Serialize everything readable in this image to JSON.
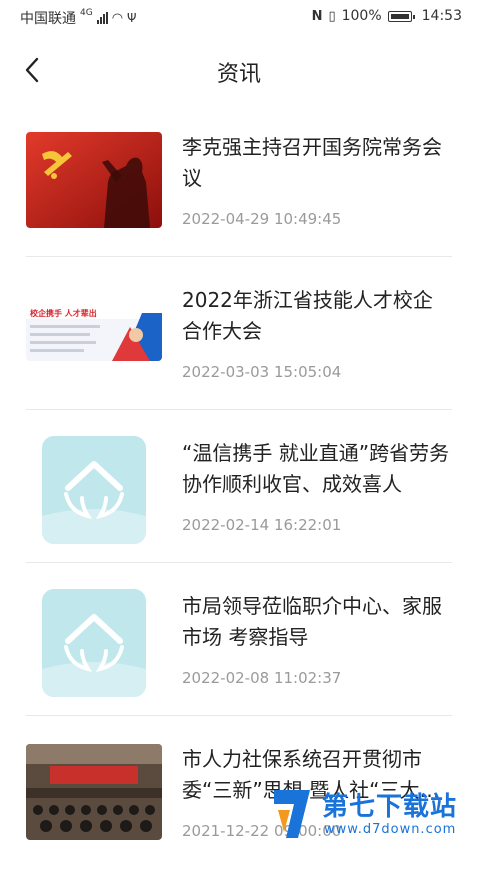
{
  "status_bar": {
    "carrier": "中国联通",
    "network": "4G",
    "battery_percent": "100%",
    "time": "14:53"
  },
  "header": {
    "title": "资讯"
  },
  "news": [
    {
      "title": "李克强主持召开国务院常务会议",
      "date": "2022-04-29 10:49:45",
      "thumb": "flag-photo"
    },
    {
      "title": "2022年浙江省技能人才校企合作大会",
      "date": "2022-03-03 15:05:04",
      "thumb": "banner",
      "thumb_text": "校企携手 人才辈出"
    },
    {
      "title": "“温信携手 就业直通”跨省劳务协作顺利收官、成效喜人",
      "date": "2022-02-14 16:22:01",
      "thumb": "placeholder-logo"
    },
    {
      "title": "市局领导莅临职介中心、家服市场 考察指导",
      "date": "2022-02-08 11:02:37",
      "thumb": "placeholder-logo"
    },
    {
      "title": "市人力社保系统召开贯彻市委“三新”思想 暨人社“三大…",
      "date": "2021-12-22 09:00:00",
      "thumb": "meeting-photo"
    }
  ],
  "watermark": {
    "title": "第七下载站",
    "url": "www.d7down.com"
  },
  "colors": {
    "placeholder_bg": "#bfe7ec",
    "placeholder_fg": "#ffffff",
    "watermark": "#1a73d9"
  }
}
